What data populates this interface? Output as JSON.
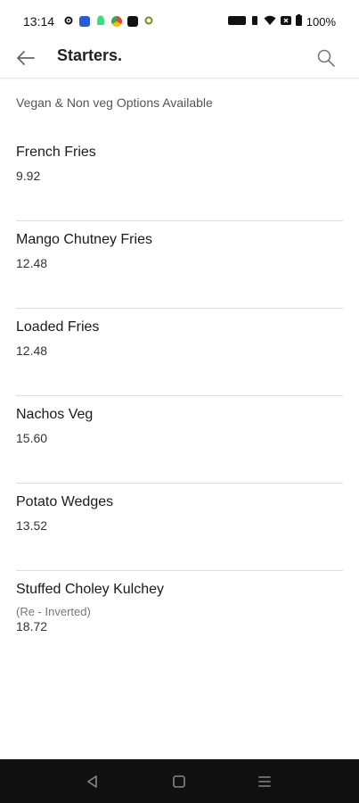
{
  "status_bar": {
    "time": "13:14",
    "battery": "100%"
  },
  "header": {
    "title": "Starters.",
    "back_icon": "arrow-left-icon",
    "search_icon": "search-icon"
  },
  "subtitle": "Vegan & Non veg Options Available",
  "menu": {
    "items": [
      {
        "name": "French Fries",
        "note": "",
        "price": "9.92"
      },
      {
        "name": "Mango Chutney Fries",
        "note": "",
        "price": "12.48"
      },
      {
        "name": "Loaded Fries",
        "note": "",
        "price": "12.48"
      },
      {
        "name": "Nachos Veg",
        "note": "",
        "price": "15.60"
      },
      {
        "name": "Potato Wedges",
        "note": "",
        "price": "13.52"
      },
      {
        "name": "Stuffed Choley Kulchey",
        "note": "(Re - Inverted)",
        "price": "18.72"
      }
    ]
  },
  "colors": {
    "divider": "#dddddd",
    "nav_bar": "#111111",
    "text_primary": "#1a1a1a",
    "text_secondary": "#555555"
  }
}
